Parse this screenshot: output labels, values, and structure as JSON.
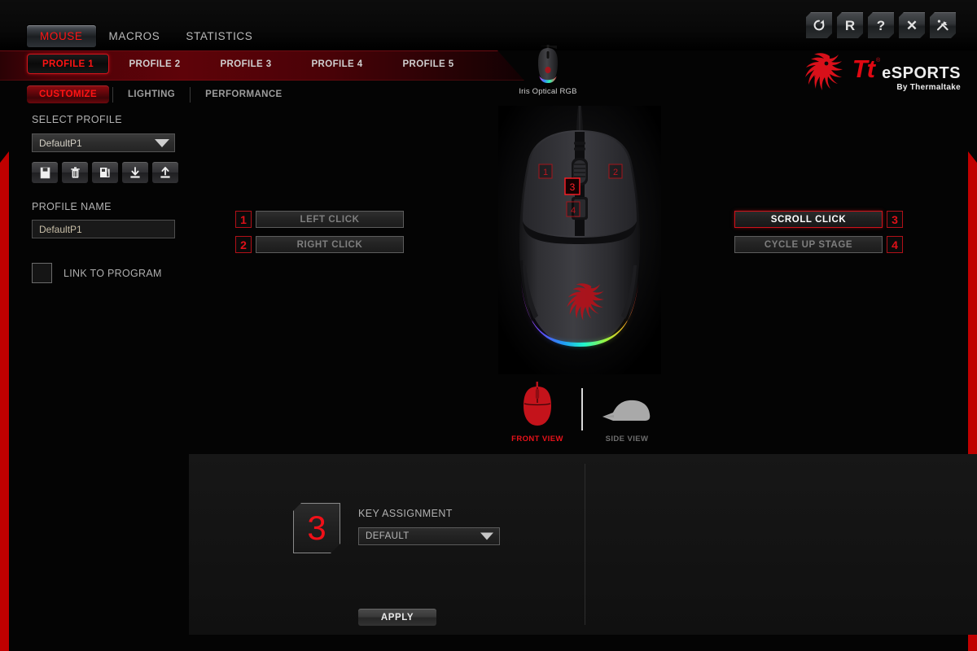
{
  "window": {
    "buttons": [
      {
        "name": "refresh-button",
        "icon": "refresh-icon",
        "label": "↻"
      },
      {
        "name": "reset-button",
        "icon": "reset-r-icon",
        "label": "R"
      },
      {
        "name": "help-button",
        "icon": "question-icon",
        "label": "?"
      },
      {
        "name": "close-button",
        "icon": "close-x-icon",
        "label": "✕"
      },
      {
        "name": "tools-button",
        "icon": "wrench-icon",
        "label": ""
      }
    ]
  },
  "main_tabs": [
    {
      "label": "MOUSE",
      "active": true
    },
    {
      "label": "MACROS",
      "active": false
    },
    {
      "label": "STATISTICS",
      "active": false
    }
  ],
  "profile_tabs": [
    {
      "label": "PROFILE 1",
      "active": true
    },
    {
      "label": "PROFILE 2",
      "active": false
    },
    {
      "label": "PROFILE 3",
      "active": false
    },
    {
      "label": "PROFILE 4",
      "active": false
    },
    {
      "label": "PROFILE 5",
      "active": false
    }
  ],
  "sub_tabs": [
    {
      "label": "CUSTOMIZE",
      "active": true
    },
    {
      "label": "LIGHTING",
      "active": false
    },
    {
      "label": "PERFORMANCE",
      "active": false
    }
  ],
  "device": {
    "name": "Iris Optical RGB"
  },
  "brand": {
    "tt": "Tt",
    "esports": "eSPORTS",
    "sub": "By Thermaltake"
  },
  "left_panel": {
    "select_profile_label": "SELECT PROFILE",
    "select_profile_value": "DefaultP1",
    "profile_name_label": "PROFILE NAME",
    "profile_name_value": "DefaultP1",
    "profile_name_placeholder": "DefaultP1",
    "tool_buttons": [
      {
        "name": "save-profile-button",
        "icon": "save-disk-icon"
      },
      {
        "name": "delete-profile-button",
        "icon": "trash-icon"
      },
      {
        "name": "copy-profile-button",
        "icon": "copy-icon"
      },
      {
        "name": "import-profile-button",
        "icon": "download-icon"
      },
      {
        "name": "export-profile-button",
        "icon": "upload-icon"
      }
    ],
    "link_to_program_label": "LINK TO PROGRAM",
    "link_to_program_checked": false
  },
  "key_assignments": {
    "left": [
      {
        "number": "1",
        "label": "LEFT CLICK",
        "selected": false
      },
      {
        "number": "2",
        "label": "RIGHT CLICK",
        "selected": false
      }
    ],
    "right": [
      {
        "number": "3",
        "label": "SCROLL CLICK",
        "selected": true
      },
      {
        "number": "4",
        "label": "CYCLE UP STAGE",
        "selected": false
      }
    ]
  },
  "mouse_markers": [
    {
      "number": "1",
      "highlighted": false
    },
    {
      "number": "2",
      "highlighted": false
    },
    {
      "number": "3",
      "highlighted": true
    },
    {
      "number": "4",
      "highlighted": false
    }
  ],
  "views": [
    {
      "label": "FRONT VIEW",
      "active": true
    },
    {
      "label": "SIDE VIEW",
      "active": false
    }
  ],
  "bottom": {
    "selected_key_number": "3",
    "key_assignment_label": "KEY ASSIGNMENT",
    "key_assignment_value": "DEFAULT",
    "apply_label": "APPLY"
  },
  "colors": {
    "accent_red": "#ff1414",
    "brand_red": "#e00812",
    "strip_red": "#c00000",
    "panel_bg": "#141414",
    "page_bg": "#040404"
  }
}
